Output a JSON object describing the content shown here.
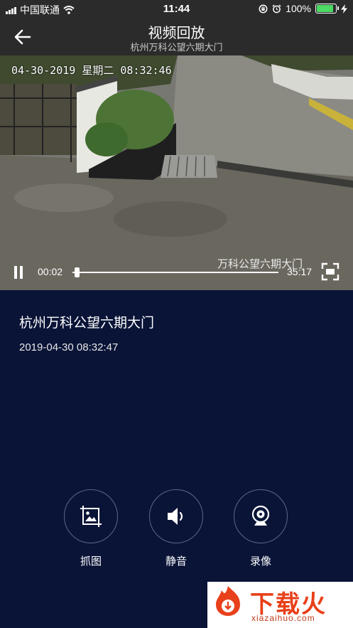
{
  "status_bar": {
    "carrier": "中国联通",
    "time": "11:44",
    "battery_pct": "100%",
    "battery_level": 1.0,
    "icons": [
      "signal-icon",
      "wifi-icon",
      "rotation-lock-icon",
      "alarm-icon",
      "battery-icon",
      "charging-icon"
    ]
  },
  "nav": {
    "title": "视频回放",
    "subtitle": "杭州万科公望六期大门",
    "back_icon": "back-arrow-icon"
  },
  "video": {
    "osd_timestamp": "04-30-2019 星期二 08:32:46",
    "osd_name": "万科公望六期大门",
    "current_time": "00:02",
    "duration": "35:17",
    "progress": 0.01,
    "state": "playing",
    "pause_icon": "pause-icon",
    "fullscreen_icon": "fullscreen-icon"
  },
  "info": {
    "camera_name": "杭州万科公望六期大门",
    "datetime": "2019-04-30 08:32:47"
  },
  "actions": [
    {
      "label": "抓图",
      "icon": "snapshot-icon"
    },
    {
      "label": "静音",
      "icon": "speaker-icon"
    },
    {
      "label": "录像",
      "icon": "webcam-icon"
    }
  ],
  "watermark": {
    "text": "下载火",
    "url": "xiazaihuo.com"
  },
  "colors": {
    "background": "#0a1437",
    "bar": "#2b2b2b",
    "battery": "#4cd964",
    "watermark": "#e8401a"
  }
}
